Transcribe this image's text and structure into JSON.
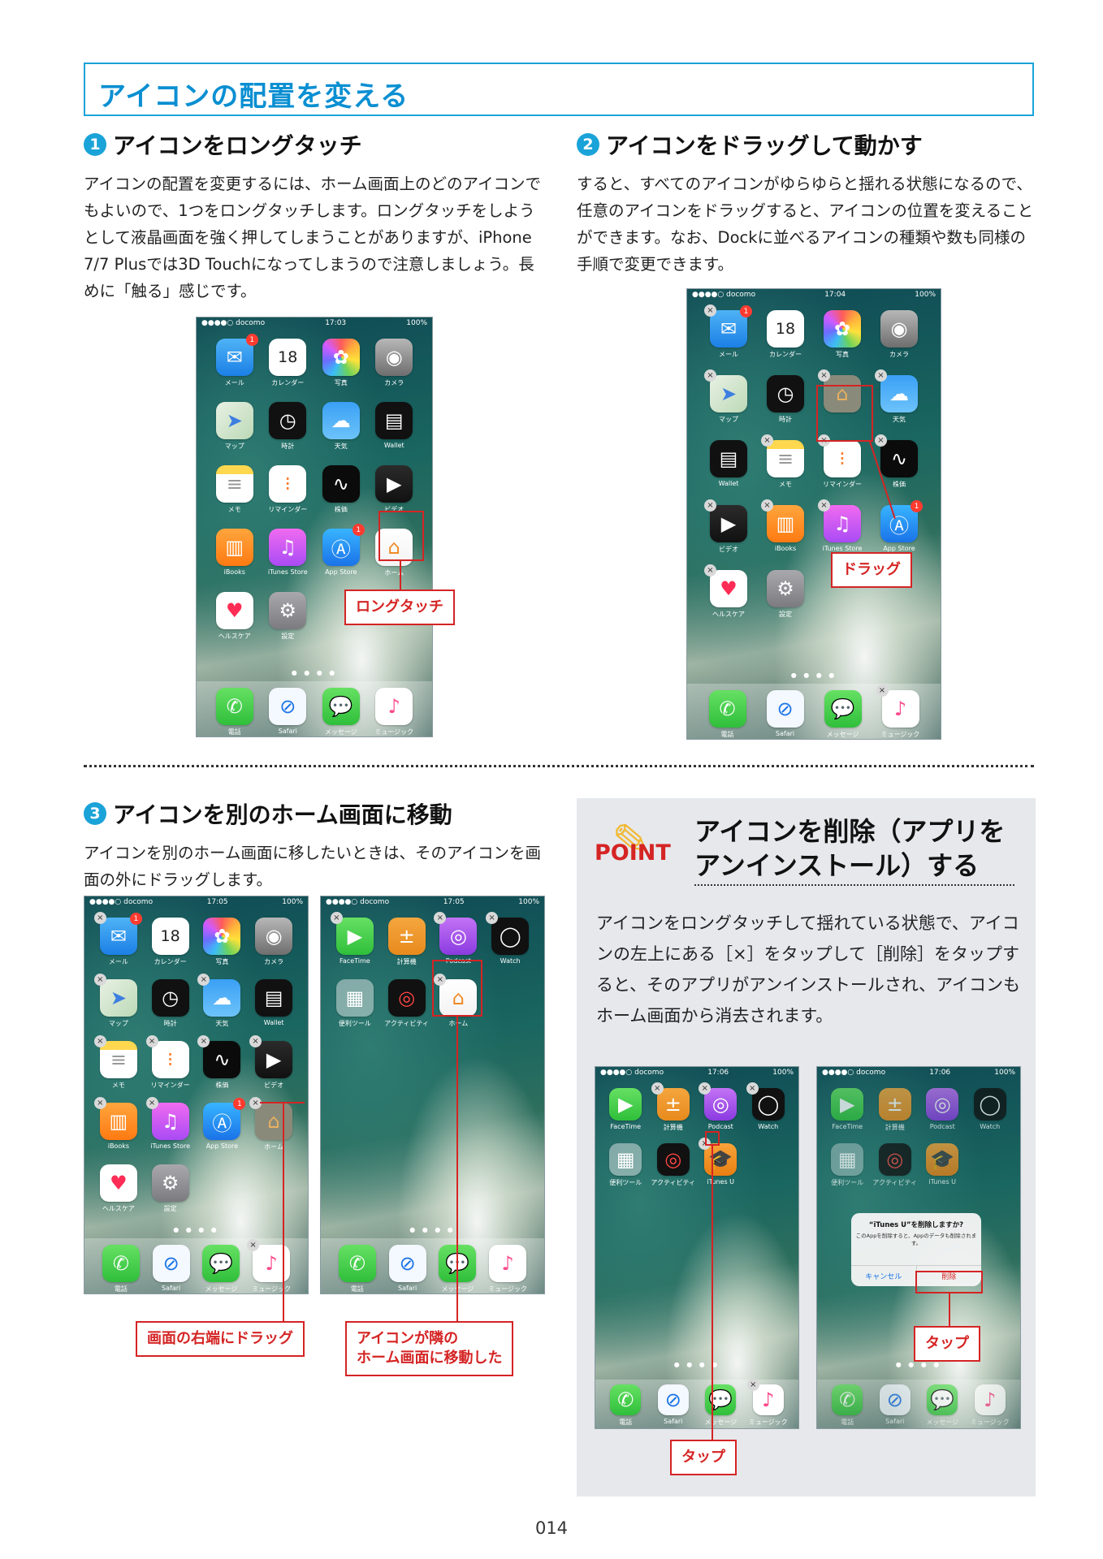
{
  "page_title": "アイコンの配置を変える",
  "step1": {
    "num": "1",
    "heading": "アイコンをロングタッチ",
    "body": "アイコンの配置を変更するには、ホーム画面上のどのアイコンでもよいので、1つをロングタッチします。ロングタッチをしようとして液晶画面を強く押してしまうことがありますが、iPhone 7/7 Plusでは3D Touchになってしまうので注意しましょう。長めに「触る」感じです。",
    "callout": "ロングタッチ"
  },
  "step2": {
    "num": "2",
    "heading": "アイコンをドラッグして動かす",
    "body": "すると、すべてのアイコンがゆらゆらと揺れる状態になるので、任意のアイコンをドラッグすると、アイコンの位置を変えることができます。なお、Dockに並べるアイコンの種類や数も同様の手順で変更できます。",
    "callout": "ドラッグ"
  },
  "step3": {
    "num": "3",
    "heading": "アイコンを別のホーム画面に移動",
    "body": "アイコンを別のホーム画面に移したいときは、そのアイコンを画面の外にドラッグします。",
    "callout_left": "画面の右端にドラッグ",
    "callout_right_line1": "アイコンが隣の",
    "callout_right_line2": "ホーム画面に移動した"
  },
  "point": {
    "label": "POINT",
    "title_line1": "アイコンを削除（アプリを",
    "title_line2": "アンインストール）する",
    "body": "アイコンをロングタッチして揺れている状態で、アイコンの左上にある［×］をタップして［削除］をタップすると、そのアプリがアンインストールされ、アイコンもホーム画面から消去されます。",
    "callout_tap1": "タップ",
    "callout_tap2": "タップ",
    "dialog_title": "“iTunes U”を削除しますか?",
    "dialog_message": "このAppを削除すると、Appのデータも削除されます。",
    "dialog_cancel": "キャンセル",
    "dialog_delete": "削除"
  },
  "status": {
    "carrier": "●●●●○ docomo",
    "battery": "100%",
    "time1": "17:03",
    "time2": "17:04",
    "time3": "17:05",
    "time4": "17:06"
  },
  "apps": {
    "mail": "メール",
    "calendar": "カレンダー",
    "calendar_day": "18",
    "photos": "写真",
    "camera": "カメラ",
    "maps": "マップ",
    "clock": "時計",
    "weather": "天気",
    "wallet": "Wallet",
    "notes": "メモ",
    "reminders": "リマインダー",
    "stocks": "株価",
    "videos": "ビデオ",
    "ibooks": "iBooks",
    "itunes": "iTunes Store",
    "appstore": "App Store",
    "home": "ホーム",
    "health": "ヘルスケア",
    "settings": "設定",
    "phone": "電話",
    "safari": "Safari",
    "messages": "メッセージ",
    "music": "ミュージック",
    "facetime": "FaceTime",
    "calculator": "計算機",
    "podcast": "Podcast",
    "watch": "Watch",
    "utilities": "便利ツール",
    "activity": "アクティビティ",
    "itunesu": "iTunes U",
    "badge": "1"
  },
  "page_number": "014"
}
